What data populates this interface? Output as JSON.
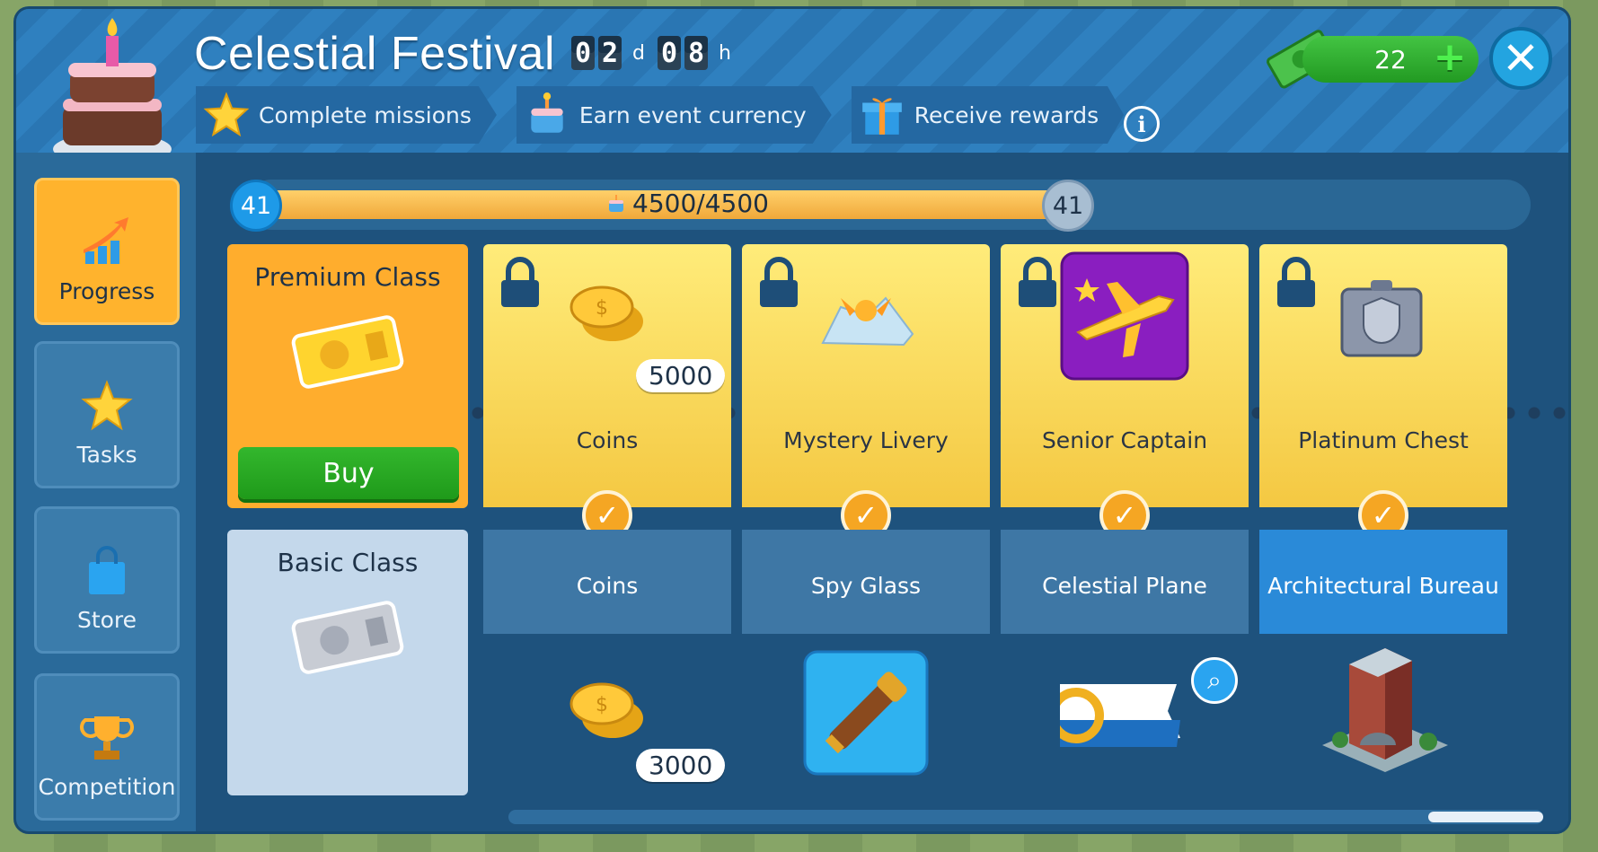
{
  "header": {
    "title": "Celestial Festival",
    "timer": {
      "days_d1": "0",
      "days_d2": "2",
      "days_unit": "d",
      "hours_d1": "0",
      "hours_d2": "8",
      "hours_unit": "h"
    },
    "steps": [
      {
        "label": "Complete missions",
        "icon": "star-icon"
      },
      {
        "label": "Earn event currency",
        "icon": "cake-currency-icon"
      },
      {
        "label": "Receive rewards",
        "icon": "gift-icon"
      }
    ],
    "currency_amount": "22",
    "info_label": "i",
    "close_label": "✕",
    "plus_label": "+"
  },
  "sidebar": {
    "items": [
      {
        "label": "Progress",
        "active": true,
        "icon": "progress-arrow-icon"
      },
      {
        "label": "Tasks",
        "active": false,
        "icon": "star-icon"
      },
      {
        "label": "Store",
        "active": false,
        "icon": "shopping-bag-icon"
      },
      {
        "label": "Competition",
        "active": false,
        "icon": "trophy-icon"
      }
    ]
  },
  "progress": {
    "level_left": "41",
    "level_right": "41",
    "text": "4500/4500",
    "fraction": 1.0
  },
  "premium": {
    "label": "Premium Class",
    "buy_label": "Buy"
  },
  "basic": {
    "label": "Basic Class"
  },
  "rewards": {
    "premium": [
      {
        "name": "Coins",
        "amount": "5000",
        "icon": "coins-icon"
      },
      {
        "name": "Mystery Livery",
        "icon": "mystery-livery-icon"
      },
      {
        "name": "Senior Captain",
        "icon": "captain-plane-icon"
      },
      {
        "name": "Platinum Chest",
        "icon": "platinum-chest-icon"
      }
    ],
    "basic": [
      {
        "name": "Coins",
        "amount": "3000",
        "icon": "coins-icon"
      },
      {
        "name": "Spy Glass",
        "icon": "spyglass-icon"
      },
      {
        "name": "Celestial Plane",
        "icon": "plane-livery-icon"
      },
      {
        "name": "Architectural Bureau",
        "icon": "building-icon"
      }
    ]
  },
  "colors": {
    "accent_orange": "#ffad2d",
    "panel_blue": "#1f5d8c",
    "green": "#2db52d"
  }
}
